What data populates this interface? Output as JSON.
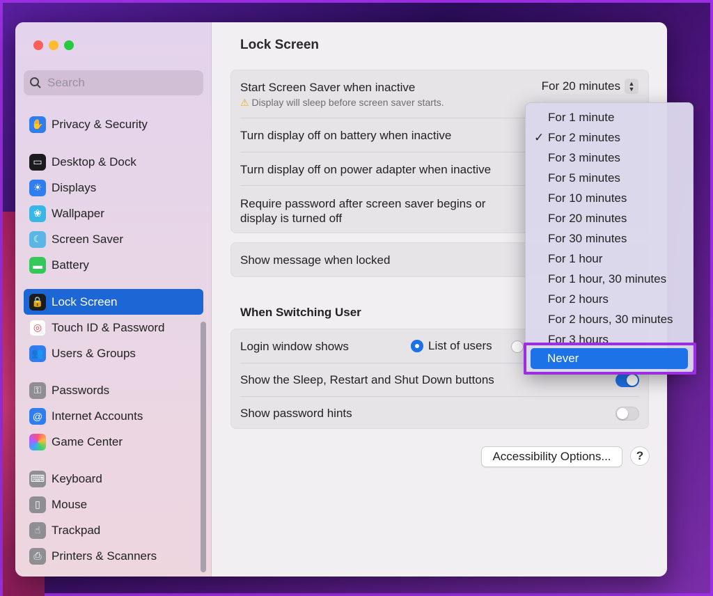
{
  "colors": {
    "accent": "#1d72e8",
    "highlight_border": "#9a2ee0"
  },
  "search": {
    "placeholder": "Search"
  },
  "sidebar": {
    "items": [
      {
        "label": "Privacy & Security",
        "icon": "hand-icon"
      },
      {
        "label": "Desktop & Dock",
        "icon": "dock-icon"
      },
      {
        "label": "Displays",
        "icon": "sun-icon"
      },
      {
        "label": "Wallpaper",
        "icon": "flower-icon"
      },
      {
        "label": "Screen Saver",
        "icon": "screensaver-icon"
      },
      {
        "label": "Battery",
        "icon": "battery-icon"
      },
      {
        "label": "Lock Screen",
        "icon": "lock-icon",
        "active": true
      },
      {
        "label": "Touch ID & Password",
        "icon": "fingerprint-icon"
      },
      {
        "label": "Users & Groups",
        "icon": "users-icon"
      },
      {
        "label": "Passwords",
        "icon": "key-icon"
      },
      {
        "label": "Internet Accounts",
        "icon": "at-icon"
      },
      {
        "label": "Game Center",
        "icon": "game-center-icon"
      },
      {
        "label": "Keyboard",
        "icon": "keyboard-icon"
      },
      {
        "label": "Mouse",
        "icon": "mouse-icon"
      },
      {
        "label": "Trackpad",
        "icon": "trackpad-icon"
      },
      {
        "label": "Printers & Scanners",
        "icon": "printer-icon"
      }
    ]
  },
  "main": {
    "title": "Lock Screen",
    "screen_saver": {
      "label": "Start Screen Saver when inactive",
      "value": "For 20 minutes",
      "warning": "Display will sleep before screen saver starts."
    },
    "battery_label": "Turn display off on battery when inactive",
    "power_label": "Turn display off on power adapter when inactive",
    "password_label_line1": "Require password after screen saver begins or",
    "password_label_line2": "display is turned off",
    "message_label": "Show message when locked",
    "switching_title": "When Switching User",
    "login_label": "Login window shows",
    "login_option": "List of users",
    "sleep_buttons_label": "Show the Sleep, Restart and Shut Down buttons",
    "password_hints_label": "Show password hints",
    "accessibility_button": "Accessibility Options...",
    "help_button": "?"
  },
  "menu": {
    "items": [
      "For 1 minute",
      "For 2 minutes",
      "For 3 minutes",
      "For 5 minutes",
      "For 10 minutes",
      "For 20 minutes",
      "For 30 minutes",
      "For 1 hour",
      "For 1 hour, 30 minutes",
      "For 2 hours",
      "For 2 hours, 30 minutes",
      "For 3 hours"
    ],
    "checked": "For 2 minutes",
    "highlighted": "Never"
  }
}
